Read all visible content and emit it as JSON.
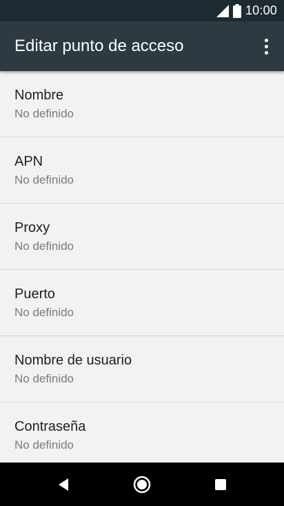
{
  "status_bar": {
    "time": "10:00",
    "icons": [
      "signal-icon",
      "battery-icon"
    ]
  },
  "app_bar": {
    "title": "Editar punto de acceso",
    "menu_icon": "more-vert-icon"
  },
  "settings": [
    {
      "title": "Nombre",
      "value": "No definido"
    },
    {
      "title": "APN",
      "value": "No definido"
    },
    {
      "title": "Proxy",
      "value": "No definido"
    },
    {
      "title": "Puerto",
      "value": "No definido"
    },
    {
      "title": "Nombre de usuario",
      "value": "No definido"
    },
    {
      "title": "Contraseña",
      "value": "No definido"
    }
  ],
  "nav_bar": {
    "icons": [
      "back-icon",
      "home-icon",
      "recents-icon"
    ]
  },
  "colors": {
    "status_bar": "#1f2b33",
    "app_bar": "#2d3a42",
    "background": "#f2f2f2",
    "nav_bar": "#000000"
  }
}
